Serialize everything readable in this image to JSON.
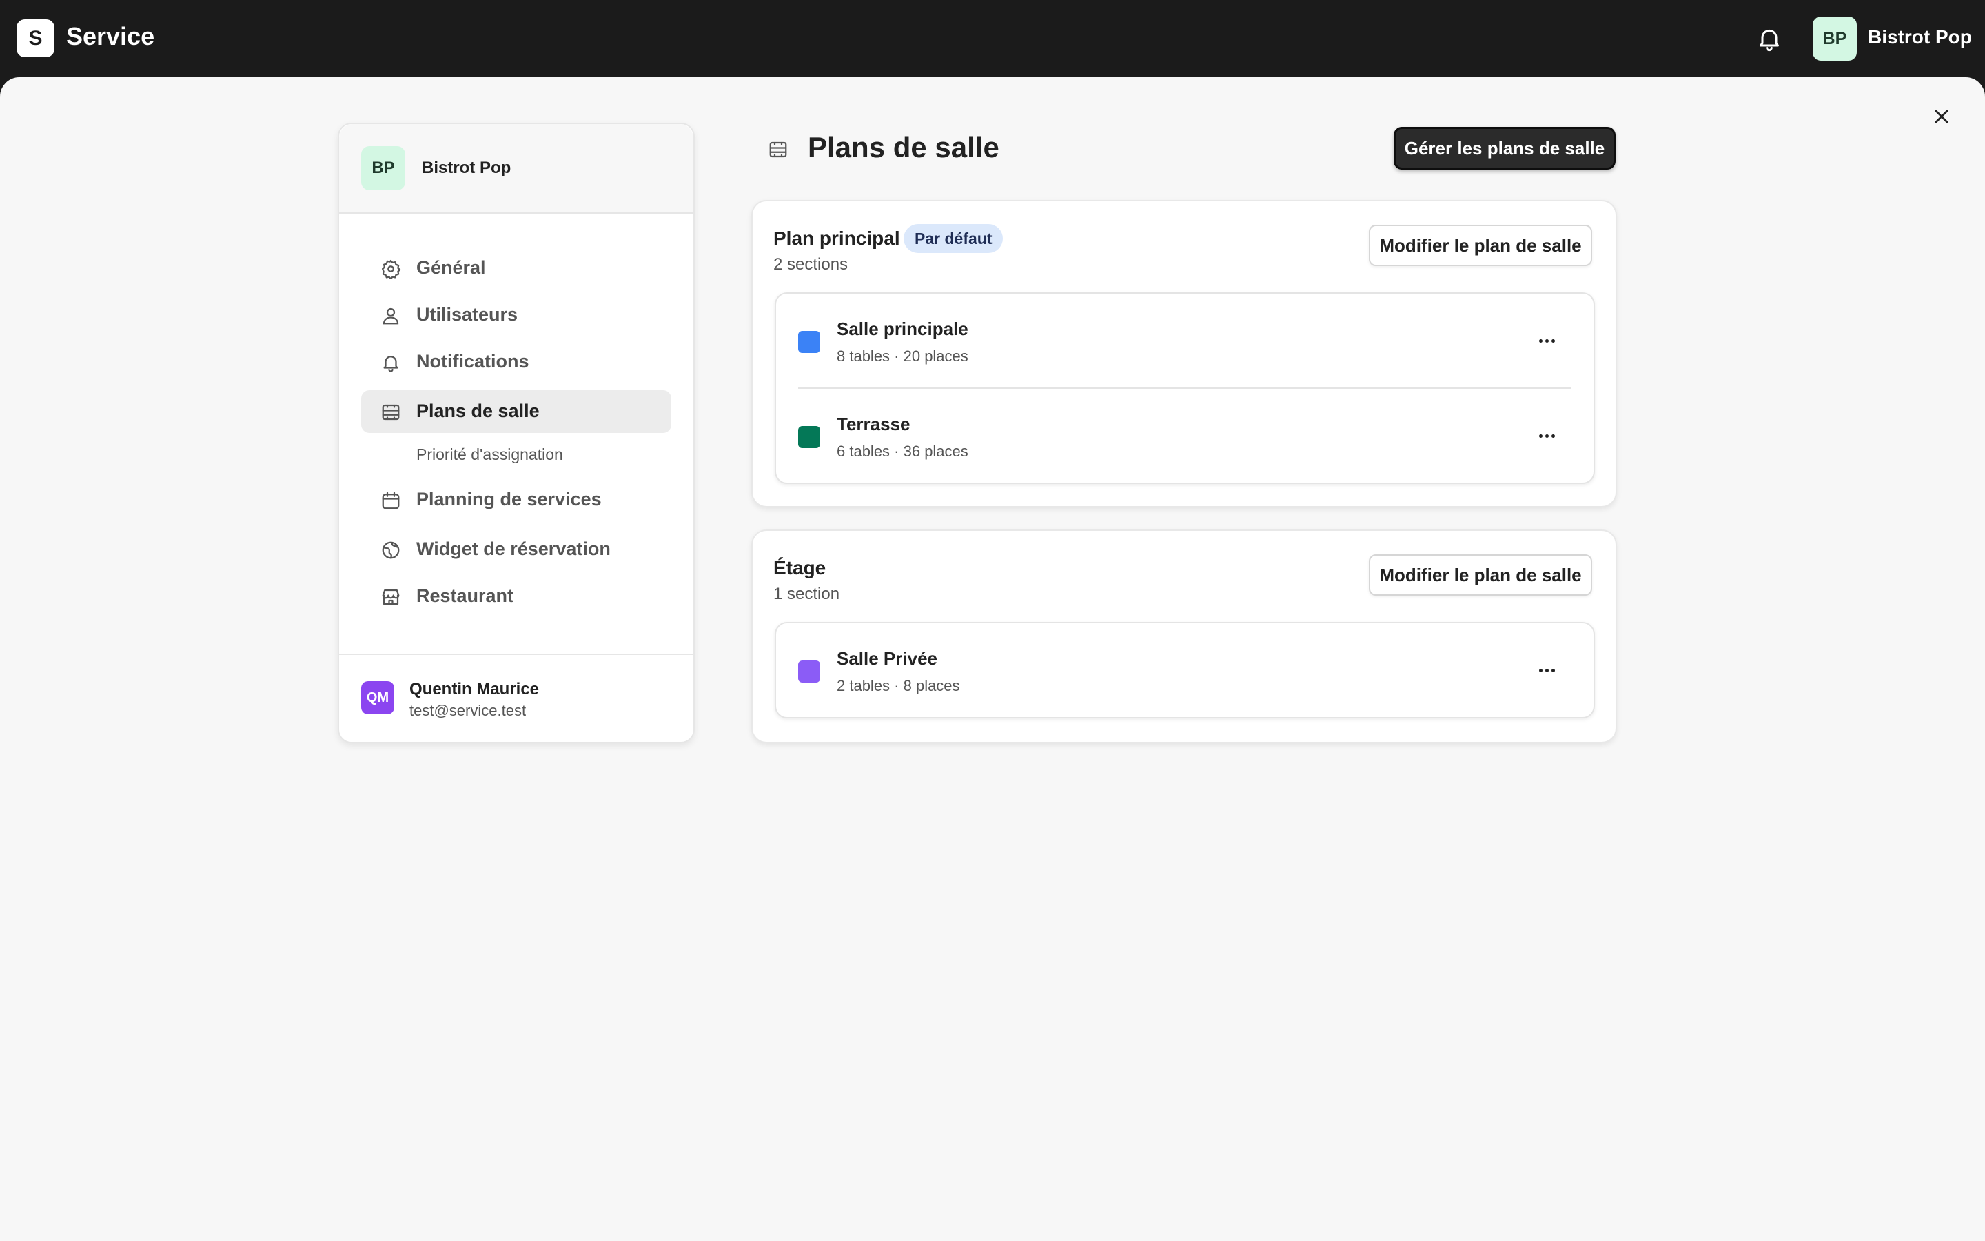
{
  "app": {
    "logo_letter": "S",
    "name": "Service"
  },
  "topbar": {
    "avatar": "BP",
    "account_name": "Bistrot Pop"
  },
  "sidebar": {
    "avatar": "BP",
    "org_name": "Bistrot Pop",
    "items": [
      {
        "label": "Général",
        "icon": "gear-icon"
      },
      {
        "label": "Utilisateurs",
        "icon": "user-icon"
      },
      {
        "label": "Notifications",
        "icon": "bell-icon"
      },
      {
        "label": "Plans de salle",
        "icon": "floor-plan-icon",
        "active": true
      },
      {
        "label": "Planning de services",
        "icon": "calendar-icon"
      },
      {
        "label": "Widget de réservation",
        "icon": "globe-icon"
      },
      {
        "label": "Restaurant",
        "icon": "store-icon"
      }
    ],
    "sub_item": "Priorité d'assignation",
    "user": {
      "initials": "QM",
      "name": "Quentin Maurice",
      "email": "test@service.test"
    }
  },
  "main": {
    "title": "Plans de salle",
    "manage_button": "Gérer les plans de salle",
    "plans": [
      {
        "name": "Plan principal",
        "badge": "Par défaut",
        "sections_count": "2 sections",
        "edit_button": "Modifier le plan de salle",
        "sections": [
          {
            "name": "Salle principale",
            "meta": "8 tables · 20 places",
            "color": "#3b82f6"
          },
          {
            "name": "Terrasse",
            "meta": "6 tables · 36 places",
            "color": "#047857"
          }
        ]
      },
      {
        "name": "Étage",
        "sections_count": "1 section",
        "edit_button": "Modifier le plan de salle",
        "sections": [
          {
            "name": "Salle Privée",
            "meta": "2 tables · 8 places",
            "color": "#8b5cf6"
          }
        ]
      }
    ]
  }
}
